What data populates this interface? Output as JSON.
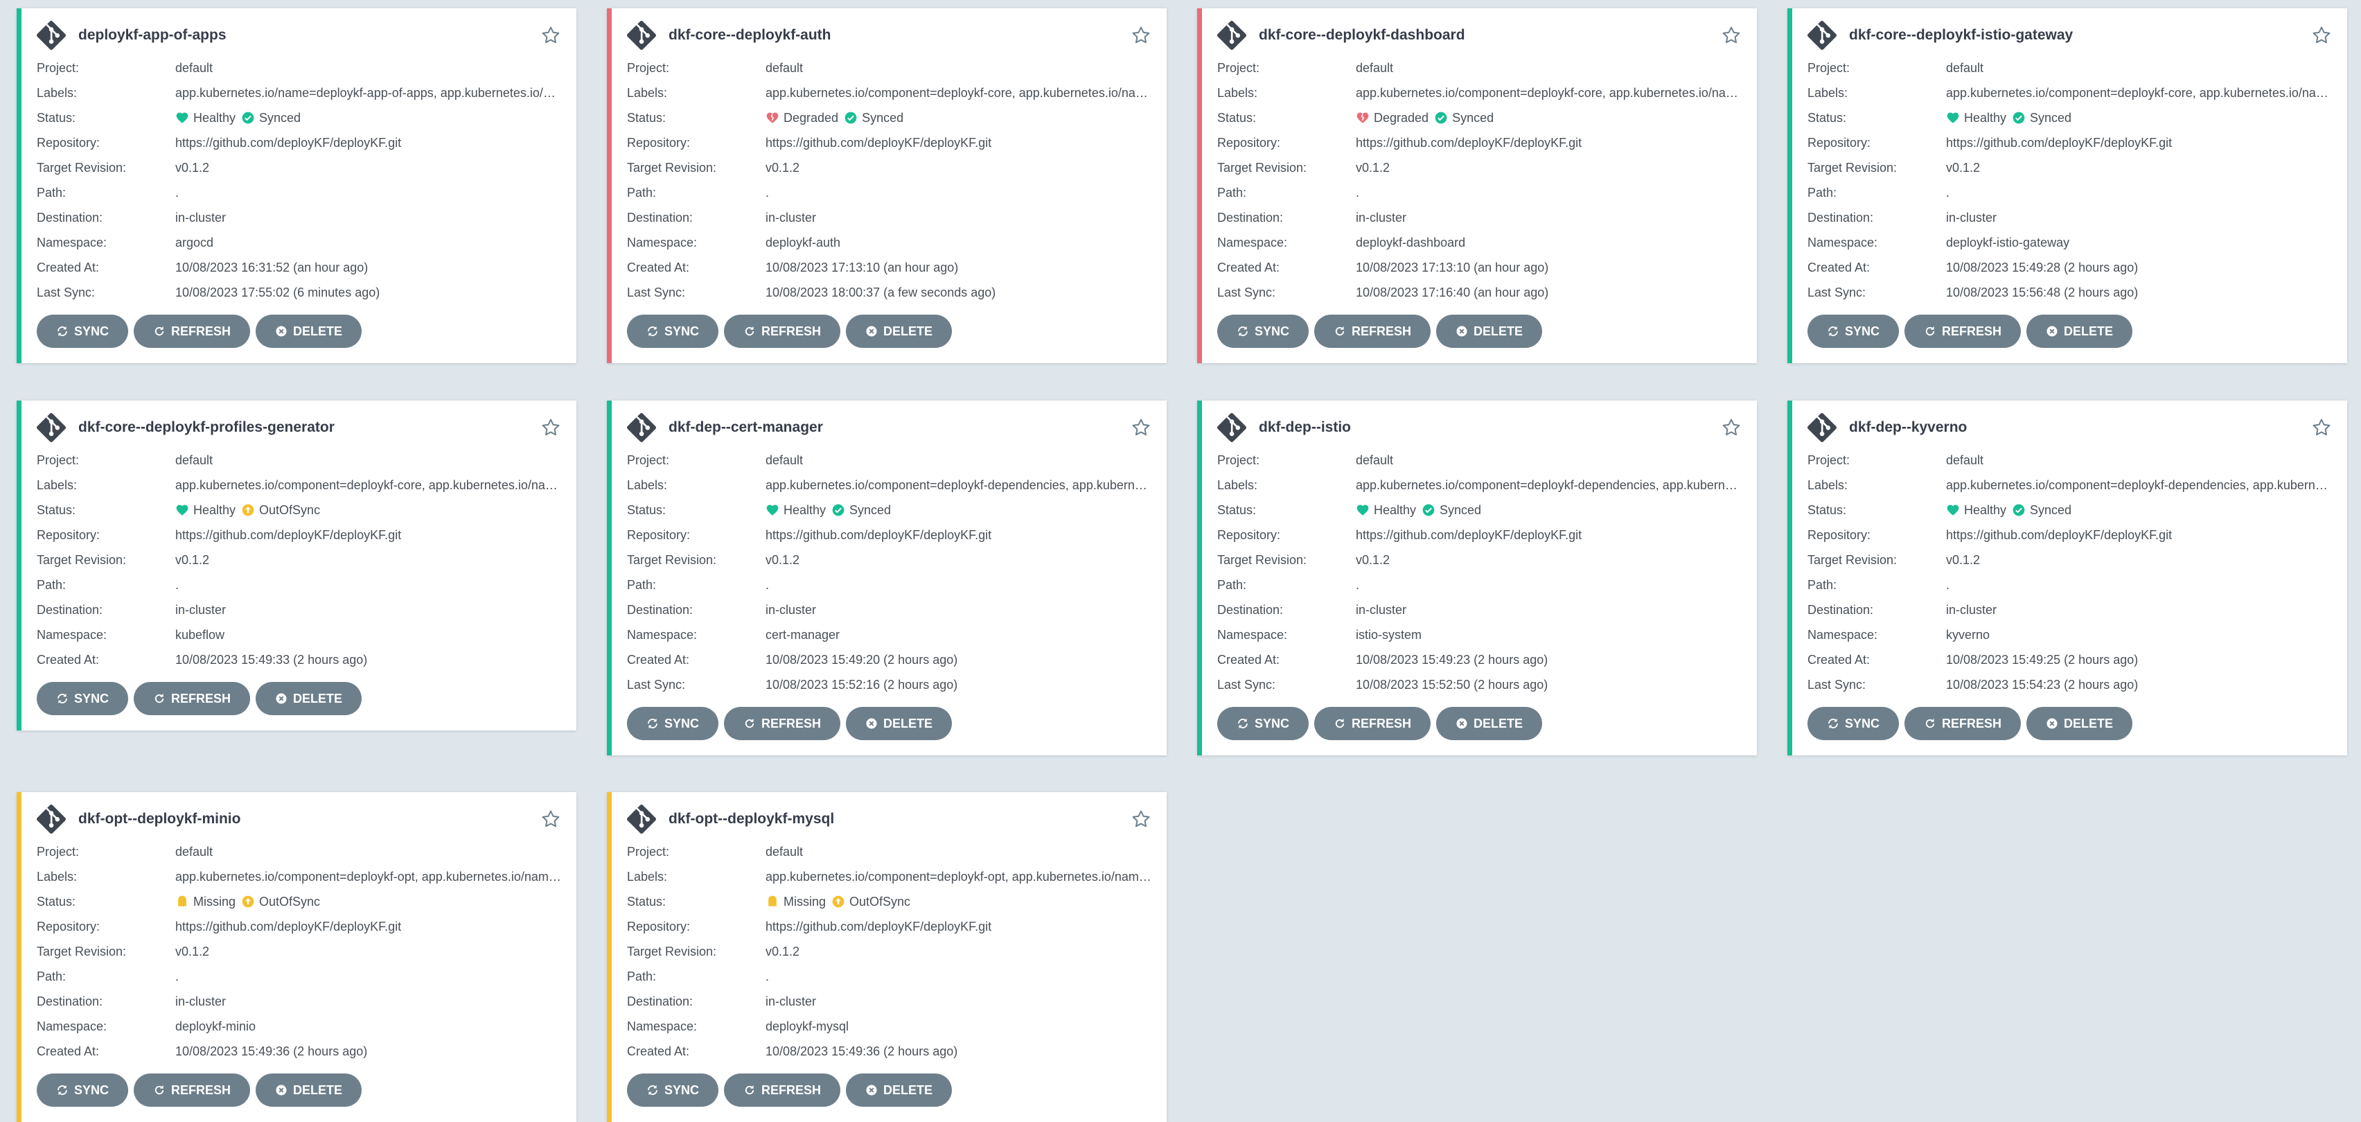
{
  "labels": {
    "project": "Project:",
    "labels": "Labels:",
    "status": "Status:",
    "repository": "Repository:",
    "target_revision": "Target Revision:",
    "path": "Path:",
    "destination": "Destination:",
    "namespace": "Namespace:",
    "created_at": "Created At:",
    "last_sync": "Last Sync:"
  },
  "buttons": {
    "sync": "SYNC",
    "refresh": "REFRESH",
    "delete": "DELETE"
  },
  "colors": {
    "healthy": "#18be94",
    "degraded": "#e96d76",
    "missing": "#f4c030",
    "button": "#6d7f8b",
    "background": "#dee6eb"
  },
  "apps": [
    {
      "name": "deploykf-app-of-apps",
      "project": "default",
      "labels": "app.kubernetes.io/name=deploykf-app-of-apps, app.kubernetes.io/component=deploykf-core",
      "health": "Healthy",
      "sync": "Synced",
      "repo": "https://github.com/deployKF/deployKF.git",
      "revision": "v0.1.2",
      "path": ".",
      "destination": "in-cluster",
      "namespace": "argocd",
      "created": "10/08/2023 16:31:52  (an hour ago)",
      "last_sync": "10/08/2023 17:55:02  (6 minutes ago)"
    },
    {
      "name": "dkf-core--deploykf-auth",
      "project": "default",
      "labels": "app.kubernetes.io/component=deploykf-core, app.kubernetes.io/name=deploykf-auth",
      "health": "Degraded",
      "sync": "Synced",
      "repo": "https://github.com/deployKF/deployKF.git",
      "revision": "v0.1.2",
      "path": ".",
      "destination": "in-cluster",
      "namespace": "deploykf-auth",
      "created": "10/08/2023 17:13:10  (an hour ago)",
      "last_sync": "10/08/2023 18:00:37  (a few seconds ago)"
    },
    {
      "name": "dkf-core--deploykf-dashboard",
      "project": "default",
      "labels": "app.kubernetes.io/component=deploykf-core, app.kubernetes.io/name=deploykf-dashboard",
      "health": "Degraded",
      "sync": "Synced",
      "repo": "https://github.com/deployKF/deployKF.git",
      "revision": "v0.1.2",
      "path": ".",
      "destination": "in-cluster",
      "namespace": "deploykf-dashboard",
      "created": "10/08/2023 17:13:10  (an hour ago)",
      "last_sync": "10/08/2023 17:16:40  (an hour ago)"
    },
    {
      "name": "dkf-core--deploykf-istio-gateway",
      "project": "default",
      "labels": "app.kubernetes.io/component=deploykf-core, app.kubernetes.io/name=deploykf-istio-gateway",
      "health": "Healthy",
      "sync": "Synced",
      "repo": "https://github.com/deployKF/deployKF.git",
      "revision": "v0.1.2",
      "path": ".",
      "destination": "in-cluster",
      "namespace": "deploykf-istio-gateway",
      "created": "10/08/2023 15:49:28  (2 hours ago)",
      "last_sync": "10/08/2023 15:56:48  (2 hours ago)"
    },
    {
      "name": "dkf-core--deploykf-profiles-generator",
      "project": "default",
      "labels": "app.kubernetes.io/component=deploykf-core, app.kubernetes.io/name=deploykf-profiles-generator",
      "health": "Healthy",
      "sync": "OutOfSync",
      "repo": "https://github.com/deployKF/deployKF.git",
      "revision": "v0.1.2",
      "path": ".",
      "destination": "in-cluster",
      "namespace": "kubeflow",
      "created": "10/08/2023 15:49:33  (2 hours ago)",
      "last_sync": null
    },
    {
      "name": "dkf-dep--cert-manager",
      "project": "default",
      "labels": "app.kubernetes.io/component=deploykf-dependencies, app.kubernetes.io/name=cert-manager",
      "health": "Healthy",
      "sync": "Synced",
      "repo": "https://github.com/deployKF/deployKF.git",
      "revision": "v0.1.2",
      "path": ".",
      "destination": "in-cluster",
      "namespace": "cert-manager",
      "created": "10/08/2023 15:49:20  (2 hours ago)",
      "last_sync": "10/08/2023 15:52:16  (2 hours ago)"
    },
    {
      "name": "dkf-dep--istio",
      "project": "default",
      "labels": "app.kubernetes.io/component=deploykf-dependencies, app.kubernetes.io/name=istio",
      "health": "Healthy",
      "sync": "Synced",
      "repo": "https://github.com/deployKF/deployKF.git",
      "revision": "v0.1.2",
      "path": ".",
      "destination": "in-cluster",
      "namespace": "istio-system",
      "created": "10/08/2023 15:49:23  (2 hours ago)",
      "last_sync": "10/08/2023 15:52:50  (2 hours ago)"
    },
    {
      "name": "dkf-dep--kyverno",
      "project": "default",
      "labels": "app.kubernetes.io/component=deploykf-dependencies, app.kubernetes.io/name=kyverno",
      "health": "Healthy",
      "sync": "Synced",
      "repo": "https://github.com/deployKF/deployKF.git",
      "revision": "v0.1.2",
      "path": ".",
      "destination": "in-cluster",
      "namespace": "kyverno",
      "created": "10/08/2023 15:49:25  (2 hours ago)",
      "last_sync": "10/08/2023 15:54:23  (2 hours ago)"
    },
    {
      "name": "dkf-opt--deploykf-minio",
      "project": "default",
      "labels": "app.kubernetes.io/component=deploykf-opt, app.kubernetes.io/name=deploykf-minio",
      "health": "Missing",
      "sync": "OutOfSync",
      "repo": "https://github.com/deployKF/deployKF.git",
      "revision": "v0.1.2",
      "path": ".",
      "destination": "in-cluster",
      "namespace": "deploykf-minio",
      "created": "10/08/2023 15:49:36  (2 hours ago)",
      "last_sync": null
    },
    {
      "name": "dkf-opt--deploykf-mysql",
      "project": "default",
      "labels": "app.kubernetes.io/component=deploykf-opt, app.kubernetes.io/name=deploykf-mysql",
      "health": "Missing",
      "sync": "OutOfSync",
      "repo": "https://github.com/deployKF/deployKF.git",
      "revision": "v0.1.2",
      "path": ".",
      "destination": "in-cluster",
      "namespace": "deploykf-mysql",
      "created": "10/08/2023 15:49:36  (2 hours ago)",
      "last_sync": null
    }
  ]
}
